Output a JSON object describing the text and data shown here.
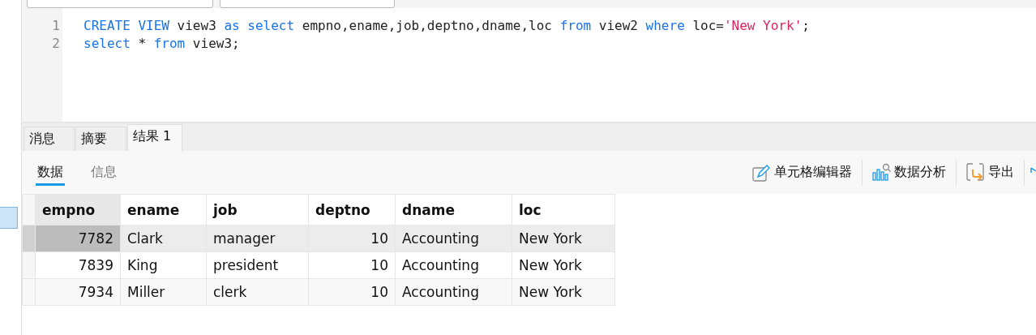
{
  "editor": {
    "lines": [
      {
        "number": "1",
        "tokens": [
          {
            "kind": "keyword",
            "text": "CREATE VIEW"
          },
          {
            "kind": "plain",
            "text": " view3 "
          },
          {
            "kind": "keyword",
            "text": "as select"
          },
          {
            "kind": "plain",
            "text": " empno,ename,job,deptno,dname,loc "
          },
          {
            "kind": "keyword",
            "text": "from"
          },
          {
            "kind": "plain",
            "text": " view2 "
          },
          {
            "kind": "keyword",
            "text": "where"
          },
          {
            "kind": "plain",
            "text": " loc="
          },
          {
            "kind": "string",
            "text": "'New York'"
          },
          {
            "kind": "plain",
            "text": ";"
          }
        ]
      },
      {
        "number": "2",
        "tokens": [
          {
            "kind": "keyword",
            "text": "select"
          },
          {
            "kind": "plain",
            "text": " * "
          },
          {
            "kind": "keyword",
            "text": "from"
          },
          {
            "kind": "plain",
            "text": " view3;"
          }
        ]
      }
    ]
  },
  "result_tabs": [
    {
      "label": "消息",
      "selected": false
    },
    {
      "label": "摘要",
      "selected": false
    },
    {
      "label": "结果 1",
      "selected": true
    }
  ],
  "sub_tabs": [
    {
      "label": "数据",
      "selected": true
    },
    {
      "label": "信息",
      "selected": false
    }
  ],
  "actions": [
    {
      "kind": "edit",
      "label": "单元格编辑器"
    },
    {
      "kind": "analyze",
      "label": "数据分析"
    },
    {
      "kind": "export",
      "label": "导出"
    }
  ],
  "table": {
    "columns": [
      {
        "label": "empno",
        "selected": true
      },
      {
        "label": "ename",
        "selected": false
      },
      {
        "label": "job",
        "selected": false
      },
      {
        "label": "deptno",
        "selected": false
      },
      {
        "label": "dname",
        "selected": false
      },
      {
        "label": "loc",
        "selected": false
      }
    ],
    "rows": [
      {
        "selected": true,
        "cells": [
          "7782",
          "Clark",
          "manager",
          "10",
          "Accounting",
          "New York"
        ]
      },
      {
        "selected": false,
        "cells": [
          "7839",
          "King",
          "president",
          "10",
          "Accounting",
          "New York"
        ]
      },
      {
        "selected": false,
        "cells": [
          "7934",
          "Miller",
          "clerk",
          "10",
          "Accounting",
          "New York"
        ]
      }
    ]
  }
}
